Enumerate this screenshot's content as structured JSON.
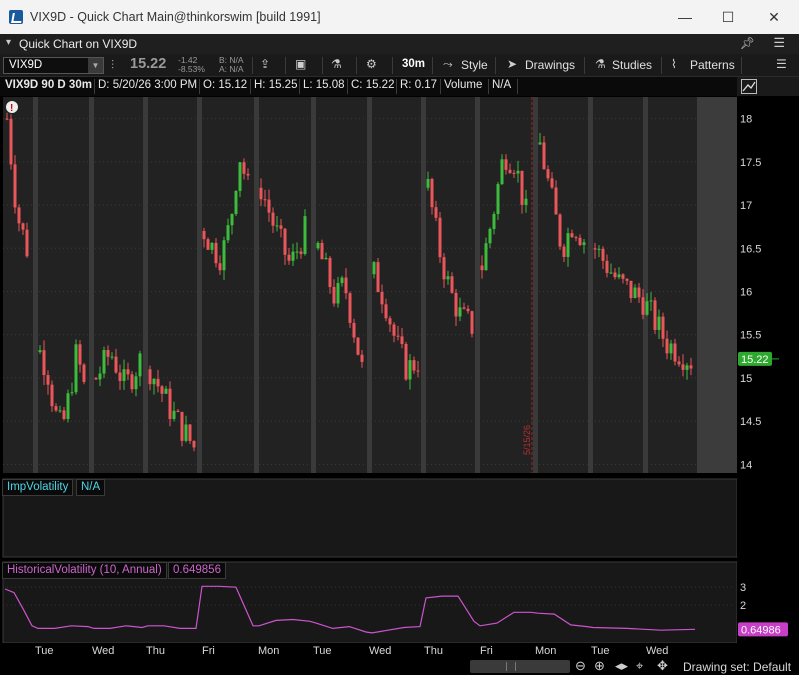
{
  "window": {
    "title": "VIX9D - Quick Chart Main@thinkorswim [build 1991]",
    "minimize": "—",
    "maximize": "☐",
    "close": "✕"
  },
  "qc_header": {
    "label": "Quick Chart on VIX9D"
  },
  "toolbar": {
    "symbol": "VIX9D",
    "last": "15.22",
    "change": "-1.42",
    "change_pct": "-8.53%",
    "bid": "B: N/A",
    "ask": "A: N/A",
    "aggregation": "30m",
    "style_label": "Style",
    "drawings_label": "Drawings",
    "studies_label": "Studies",
    "patterns_label": "Patterns"
  },
  "quote_strip": {
    "title": "VIX9D 90 D 30m",
    "date": "D: 5/20/26 3:00 PM",
    "open": "O: 15.12",
    "high": "H: 15.25",
    "low": "L: 15.08",
    "close": "C: 15.22",
    "range": "R: 0.17",
    "volume_label": "Volume",
    "volume_value": "N/A"
  },
  "chart_data": [
    {
      "type": "candlestick",
      "price_axis_ticks": [
        "18",
        "17.5",
        "17",
        "16.5",
        "16",
        "15.5",
        "15",
        "14.5",
        "14"
      ],
      "ylim": [
        13.9,
        18.25
      ],
      "last_price_tag": "15.22",
      "session_marker_label": "5/15/26",
      "x_tick_labels": [
        "Tue",
        "Wed",
        "Thu",
        "Fri",
        "Mon",
        "Tue",
        "Wed",
        "Thu",
        "Fri",
        "Mon",
        "Tue",
        "Wed"
      ],
      "up_color": "#3dbb3d",
      "down_color": "#e9575a"
    },
    {
      "type": "line",
      "name": "ImpVolatility",
      "value": "N/A"
    },
    {
      "type": "line",
      "name": "HistoricalVolatility (10, Annual)",
      "value": "0.649856",
      "price_tag": "0.64986",
      "y_ticks": [
        "3",
        "2"
      ],
      "ylim": [
        0,
        3.4
      ],
      "color": "#cc55cc",
      "series_by_day": [
        [
          2.9,
          2.7,
          1.8,
          0.85
        ],
        [
          0.7,
          0.7,
          0.85,
          0.8
        ],
        [
          0.7,
          0.7,
          0.85,
          0.75
        ],
        [
          0.85,
          0.85,
          0.7,
          0.7
        ],
        [
          3.05,
          3.05,
          3.0,
          0.85
        ],
        [
          0.85,
          1.15,
          1.2,
          1.1
        ],
        [
          1.0,
          0.7,
          0.8,
          0.5
        ],
        [
          0.45,
          0.6,
          0.75,
          0.8
        ],
        [
          2.4,
          2.5,
          2.5,
          1.1
        ],
        [
          0.85,
          1.0,
          1.6,
          1.6
        ],
        [
          1.55,
          1.5,
          0.9,
          0.8
        ],
        [
          0.75,
          0.7,
          0.6,
          0.65
        ]
      ]
    }
  ],
  "bottom_bar": {
    "drawing_set": "Drawing set: Default"
  },
  "colors": {
    "chart_bg": "#222222",
    "session_gap": "#3a3a3a",
    "last_tag": "#2ea82e",
    "hv_tag": "#c73fc7"
  }
}
